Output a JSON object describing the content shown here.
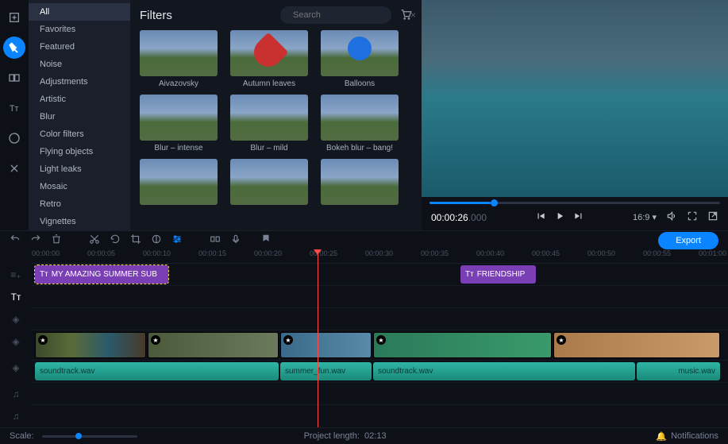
{
  "sidebar": {
    "items": [
      {
        "label": "All"
      },
      {
        "label": "Favorites"
      },
      {
        "label": "Featured"
      },
      {
        "label": "Noise"
      },
      {
        "label": "Adjustments"
      },
      {
        "label": "Artistic"
      },
      {
        "label": "Blur"
      },
      {
        "label": "Color filters"
      },
      {
        "label": "Flying objects"
      },
      {
        "label": "Light leaks"
      },
      {
        "label": "Mosaic"
      },
      {
        "label": "Retro"
      },
      {
        "label": "Vignettes"
      }
    ]
  },
  "filters": {
    "title": "Filters",
    "search_placeholder": "Search",
    "items": [
      {
        "label": "Aivazovsky"
      },
      {
        "label": "Autumn leaves"
      },
      {
        "label": "Balloons"
      },
      {
        "label": "Blur – intense"
      },
      {
        "label": "Blur – mild"
      },
      {
        "label": "Bokeh blur – bang!"
      }
    ]
  },
  "preview": {
    "timecode_main": "00:00:26",
    "timecode_ms": ".000",
    "aspect": "16:9"
  },
  "toolbar": {
    "export_label": "Export"
  },
  "ruler": {
    "marks": [
      "00:00:00",
      "00:00:05",
      "00:00:10",
      "00:00:15",
      "00:00:20",
      "00:00:25",
      "00:00:30",
      "00:00:35",
      "00:00:40",
      "00:00:45",
      "00:00:50",
      "00:00:55",
      "00:01:00"
    ]
  },
  "clips": {
    "title1": "MY AMAZING SUMMER SUB",
    "title2": "FRIENDSHIP",
    "audio1": "soundtrack.wav",
    "audio2": "summer_fun.wav",
    "audio3": "soundtrack.wav",
    "audio4": "music.wav"
  },
  "status": {
    "scale_label": "Scale:",
    "project_length_label": "Project length:",
    "project_length_value": "02:13",
    "notifications_label": "Notifications"
  }
}
